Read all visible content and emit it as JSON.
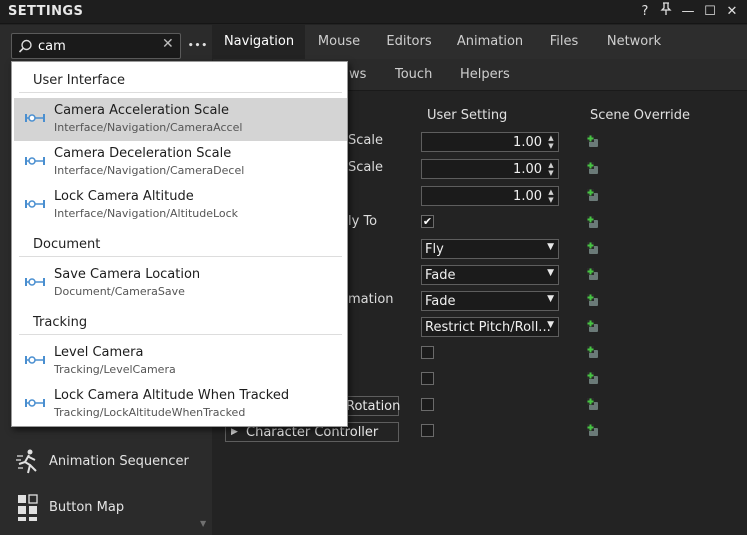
{
  "titlebar": {
    "title": "SETTINGS",
    "help": "?",
    "pin": "ф",
    "minimize": "—",
    "maximize": "☐",
    "close": "✕"
  },
  "search": {
    "value": "cam",
    "clear": "✕",
    "more": "•••"
  },
  "left_items": [
    {
      "label": "Animation Sequencer",
      "icon": "runner-icon"
    },
    {
      "label": "Button Map",
      "icon": "grid-icon"
    }
  ],
  "tabs": [
    "Navigation",
    "Mouse",
    "Editors",
    "Animation",
    "Files",
    "Network"
  ],
  "active_tab": "Navigation",
  "subtabs": [
    "ws",
    "Touch",
    "Helpers"
  ],
  "columns": {
    "user": "User Setting",
    "scene": "Scene Override"
  },
  "rows": {
    "r1_label": "Scale",
    "r2_label": "Scale",
    "r4_label": "ly To",
    "r7_label": "mation",
    "exp1": "Rotation",
    "exp2": "Character Controller",
    "num1": "1.00",
    "num2": "1.00",
    "num3": "1.00",
    "check1": "✔",
    "drop1": "Fly",
    "drop2": "Fade",
    "drop3": "Fade",
    "drop4": "Restrict Pitch/Roll..."
  },
  "results": [
    {
      "section": "User Interface",
      "items": [
        {
          "name": "Camera Acceleration Scale",
          "path": "Interface/Navigation/CameraAccel",
          "selected": true
        },
        {
          "name": "Camera Deceleration Scale",
          "path": "Interface/Navigation/CameraDecel"
        },
        {
          "name": "Lock Camera Altitude",
          "path": "Interface/Navigation/AltitudeLock"
        }
      ]
    },
    {
      "section": "Document",
      "items": [
        {
          "name": "Save Camera Location",
          "path": "Document/CameraSave"
        }
      ]
    },
    {
      "section": "Tracking",
      "items": [
        {
          "name": "Level Camera",
          "path": "Tracking/LevelCamera"
        },
        {
          "name": "Lock Camera Altitude When Tracked",
          "path": "Tracking/LockAltitudeWhenTracked"
        }
      ]
    }
  ],
  "colors": {
    "accent": "#4a8fd0",
    "override_green": "#46c443"
  }
}
